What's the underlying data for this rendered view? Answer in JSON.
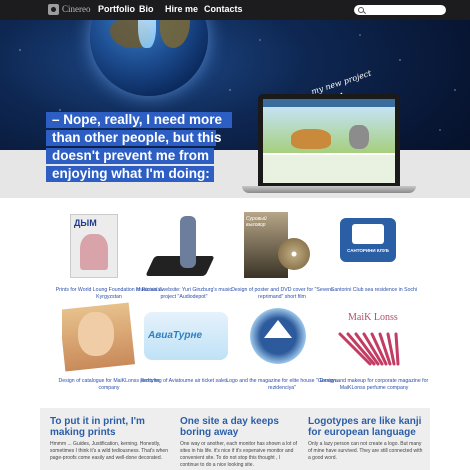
{
  "nav": {
    "logo": "Cinereo",
    "items": [
      "Portfolio",
      "Bio",
      "Hire me",
      "Contacts"
    ]
  },
  "hero": {
    "annotation": "my new project",
    "quote_lines": [
      "– Nope, really, I need more",
      "than other people, but this",
      "doesn't prevent me from",
      "enjoying what I'm doing:"
    ]
  },
  "portfolio": [
    {
      "caption": "Prints for World Loung Foundation in Russia & Kyrgyzstan",
      "thumb_text": "ДЫМ"
    },
    {
      "caption": "Musician's website: Yuri Ginzburg's music project \"Audiodepot\"",
      "thumb_text": ""
    },
    {
      "caption": "Design of poster and DVD cover for \"Severe reprimand\" short film",
      "thumb_text": "Суровый выговор"
    },
    {
      "caption": "Santorini Club sea residence in Sochi",
      "thumb_text": "САНТОРИНИ КЛУБ"
    },
    {
      "caption": "Design of catalogue for MaiKLonss perfume company",
      "thumb_text": ""
    },
    {
      "caption": "Restyling of Aviatourne air ticket sales",
      "thumb_text": "АвиаТурне"
    },
    {
      "caption": "Logo and the magazine for elite house \"Gornaya rezidenciya\"",
      "thumb_text": ""
    },
    {
      "caption": "Design and makeup for corporate magazine for MaiKLonss perfume company",
      "thumb_text": "MaiK Lonss"
    }
  ],
  "bottom": [
    {
      "title": "To put it in print, I'm making prints",
      "text": "Hmmm ... Guides, Justification, kerning. Honestly, sometimes I think it's a wild tediousness. That's when page-proofs come easily and well-done decorated."
    },
    {
      "title": "One site a day keeps boring away",
      "text": "One way or another, each monitor has shown a lot of sites in his life. it's nice if it's expensive monitor and convenient site. To do not stop this thought , I continue to do a nice looking site."
    },
    {
      "title": "Logotypes are like kanji for european language",
      "text": "Only a lazy person can not create a logo. But many of mine have survived. They are still connected with a good word."
    }
  ]
}
